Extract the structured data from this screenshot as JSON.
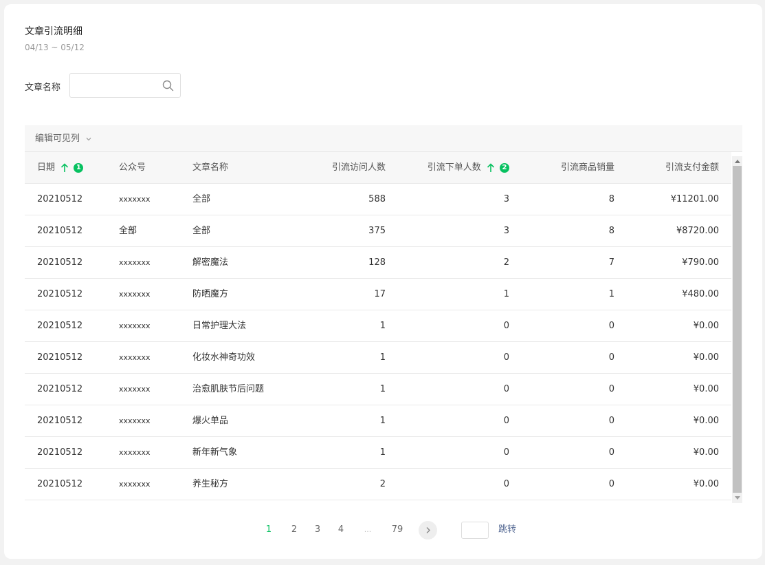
{
  "header": {
    "title": "文章引流明细",
    "date_range": "04/13 ~ 05/12"
  },
  "filter": {
    "label": "文章名称",
    "value": "",
    "placeholder": "",
    "icon": "search-icon"
  },
  "table": {
    "toolbar_label": "编辑可见列",
    "columns": [
      "日期",
      "公众号",
      "文章名称",
      "引流访问人数",
      "引流下单人数",
      "引流商品销量",
      "引流支付金额"
    ],
    "sort": {
      "date_badge": "1",
      "orders_badge": "2",
      "accent": "#07c160"
    },
    "rows": [
      {
        "date": "20210512",
        "account": "xxxxxxx",
        "article": "全部",
        "visitors": "588",
        "orders": "3",
        "sales": "8",
        "amount": "¥11201.00"
      },
      {
        "date": "20210512",
        "account": "全部",
        "article": "全部",
        "visitors": "375",
        "orders": "3",
        "sales": "8",
        "amount": "¥8720.00"
      },
      {
        "date": "20210512",
        "account": "xxxxxxx",
        "article": "解密魔法",
        "visitors": "128",
        "orders": "2",
        "sales": "7",
        "amount": "¥790.00"
      },
      {
        "date": "20210512",
        "account": "xxxxxxx",
        "article": "防晒魔方",
        "visitors": "17",
        "orders": "1",
        "sales": "1",
        "amount": "¥480.00"
      },
      {
        "date": "20210512",
        "account": "xxxxxxx",
        "article": "日常护理大法",
        "visitors": "1",
        "orders": "0",
        "sales": "0",
        "amount": "¥0.00"
      },
      {
        "date": "20210512",
        "account": "xxxxxxx",
        "article": "化妆水神奇功效",
        "visitors": "1",
        "orders": "0",
        "sales": "0",
        "amount": "¥0.00"
      },
      {
        "date": "20210512",
        "account": "xxxxxxx",
        "article": "治愈肌肤节后问题",
        "visitors": "1",
        "orders": "0",
        "sales": "0",
        "amount": "¥0.00"
      },
      {
        "date": "20210512",
        "account": "xxxxxxx",
        "article": "爆火单品",
        "visitors": "1",
        "orders": "0",
        "sales": "0",
        "amount": "¥0.00"
      },
      {
        "date": "20210512",
        "account": "xxxxxxx",
        "article": "新年新气象",
        "visitors": "1",
        "orders": "0",
        "sales": "0",
        "amount": "¥0.00"
      },
      {
        "date": "20210512",
        "account": "xxxxxxx",
        "article": "养生秘方",
        "visitors": "2",
        "orders": "0",
        "sales": "0",
        "amount": "¥0.00"
      }
    ]
  },
  "pagination": {
    "pages": [
      "1",
      "2",
      "3",
      "4",
      "...",
      "79"
    ],
    "current": "1",
    "jump_value": "",
    "jump_label": "跳转"
  }
}
